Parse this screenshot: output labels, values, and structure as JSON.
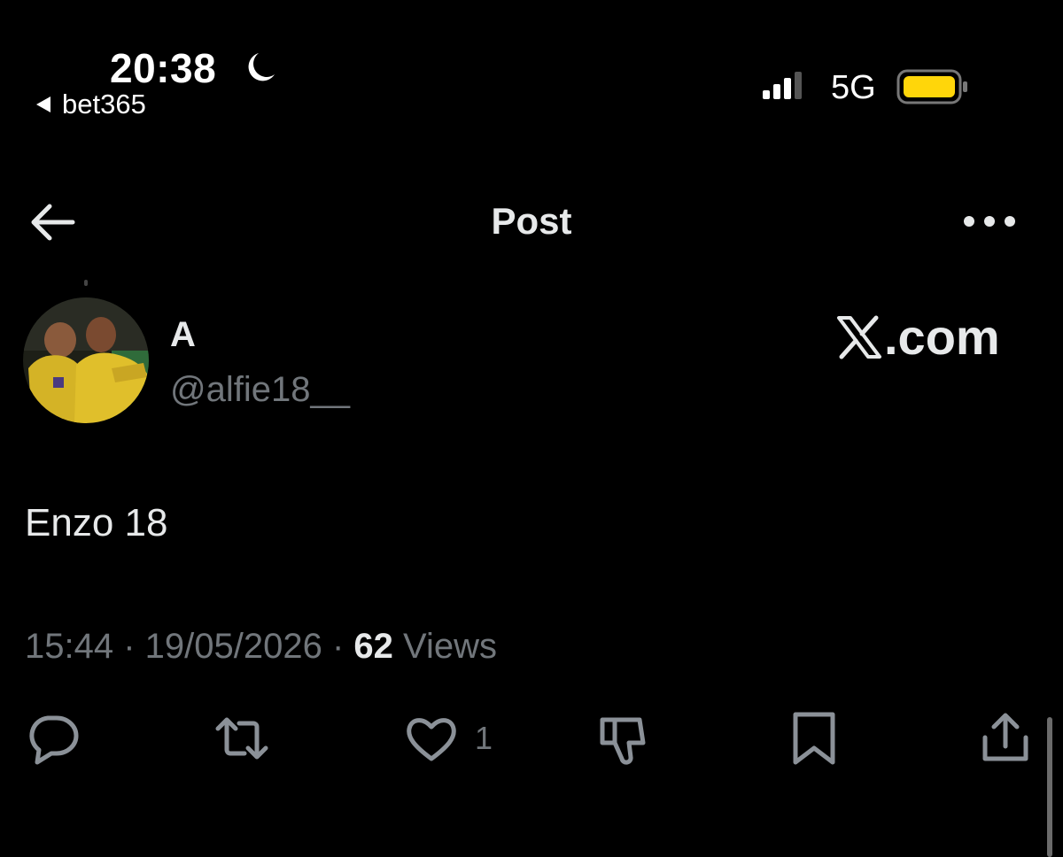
{
  "status_bar": {
    "time": "20:38",
    "back_app": "bet365",
    "network": "5G",
    "battery_color": "#ffd60a",
    "icons": [
      "moon-icon",
      "signal-icon",
      "battery-icon"
    ]
  },
  "header": {
    "title": "Post",
    "icons": [
      "back-arrow-icon",
      "more-icon"
    ]
  },
  "author": {
    "display_name": "A",
    "handle": "@alfie18__"
  },
  "watermark": {
    "brand": ".com"
  },
  "post": {
    "text": "Enzo 18",
    "time": "15:44",
    "separator": " · ",
    "date": "19/05/2026",
    "views_count": "62",
    "views_label": "Views"
  },
  "actions": {
    "like_count": "1",
    "icons": [
      "reply-icon",
      "repost-icon",
      "like-icon",
      "dislike-icon",
      "bookmark-icon",
      "share-icon"
    ]
  },
  "colors": {
    "background": "#000000",
    "text": "#e7e9ea",
    "muted": "#71767b",
    "icon": "#8b9198"
  }
}
